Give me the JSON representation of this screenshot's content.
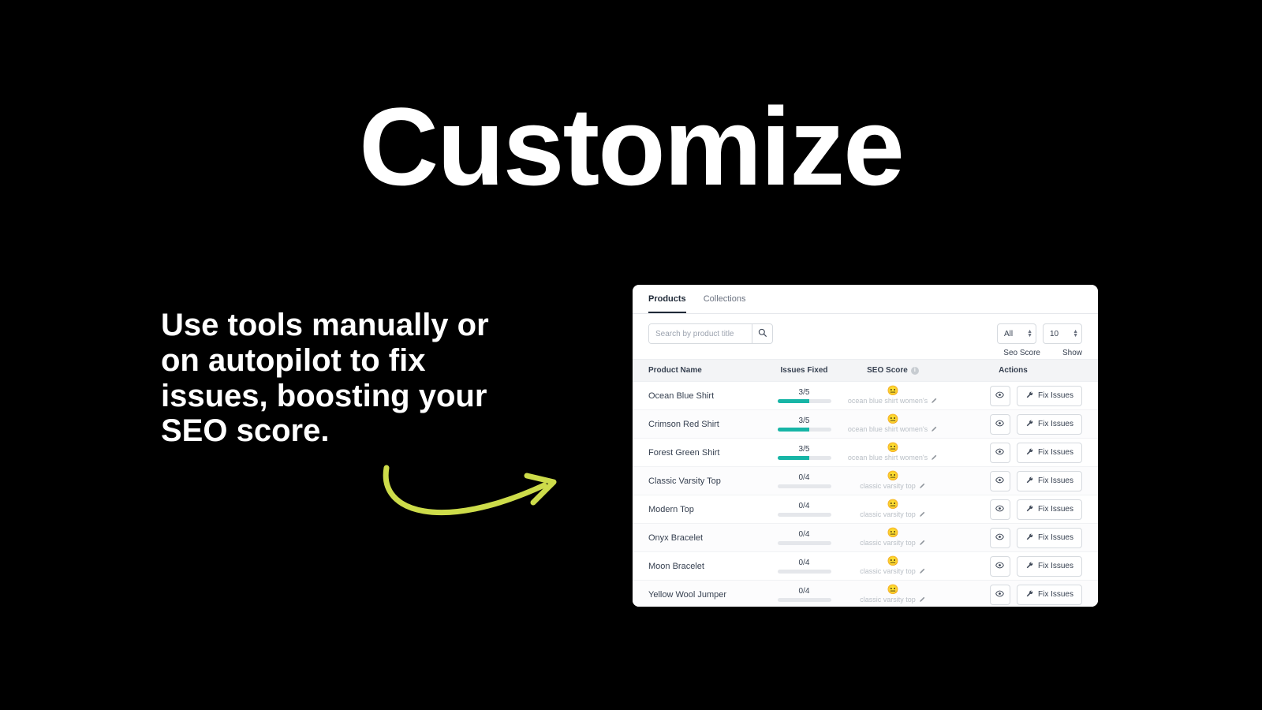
{
  "headline": "Customize",
  "subtext": "Use tools manually or on autopilot to fix issues, boosting your SEO score.",
  "panel": {
    "tabs": {
      "products": "Products",
      "collections": "Collections",
      "active": "products"
    },
    "search_placeholder": "Search by product title",
    "filter_label": "All",
    "pagesize_label": "10",
    "meta_seo": "Seo Score",
    "meta_show": "Show",
    "columns": {
      "name": "Product Name",
      "issues": "Issues Fixed",
      "seo": "SEO Score",
      "actions": "Actions"
    },
    "fix_label": "Fix Issues",
    "rows": [
      {
        "name": "Ocean Blue Shirt",
        "issues_fixed": 3,
        "issues_total": 5,
        "seo_emoji": "😐",
        "seo_text": "ocean blue shirt women's"
      },
      {
        "name": "Crimson Red Shirt",
        "issues_fixed": 3,
        "issues_total": 5,
        "seo_emoji": "😐",
        "seo_text": "ocean blue shirt women's"
      },
      {
        "name": "Forest Green Shirt",
        "issues_fixed": 3,
        "issues_total": 5,
        "seo_emoji": "😐",
        "seo_text": "ocean blue shirt women's"
      },
      {
        "name": "Classic Varsity Top",
        "issues_fixed": 0,
        "issues_total": 4,
        "seo_emoji": "😐",
        "seo_text": "classic varsity top"
      },
      {
        "name": "Modern Top",
        "issues_fixed": 0,
        "issues_total": 4,
        "seo_emoji": "😐",
        "seo_text": "classic varsity top"
      },
      {
        "name": "Onyx Bracelet",
        "issues_fixed": 0,
        "issues_total": 4,
        "seo_emoji": "😐",
        "seo_text": "classic varsity top"
      },
      {
        "name": "Moon Bracelet",
        "issues_fixed": 0,
        "issues_total": 4,
        "seo_emoji": "😐",
        "seo_text": "classic varsity top"
      },
      {
        "name": "Yellow Wool Jumper",
        "issues_fixed": 0,
        "issues_total": 4,
        "seo_emoji": "😐",
        "seo_text": "classic varsity top"
      }
    ]
  },
  "colors": {
    "accent_arrow": "#cddc4a",
    "progress": "#17b5a6"
  }
}
